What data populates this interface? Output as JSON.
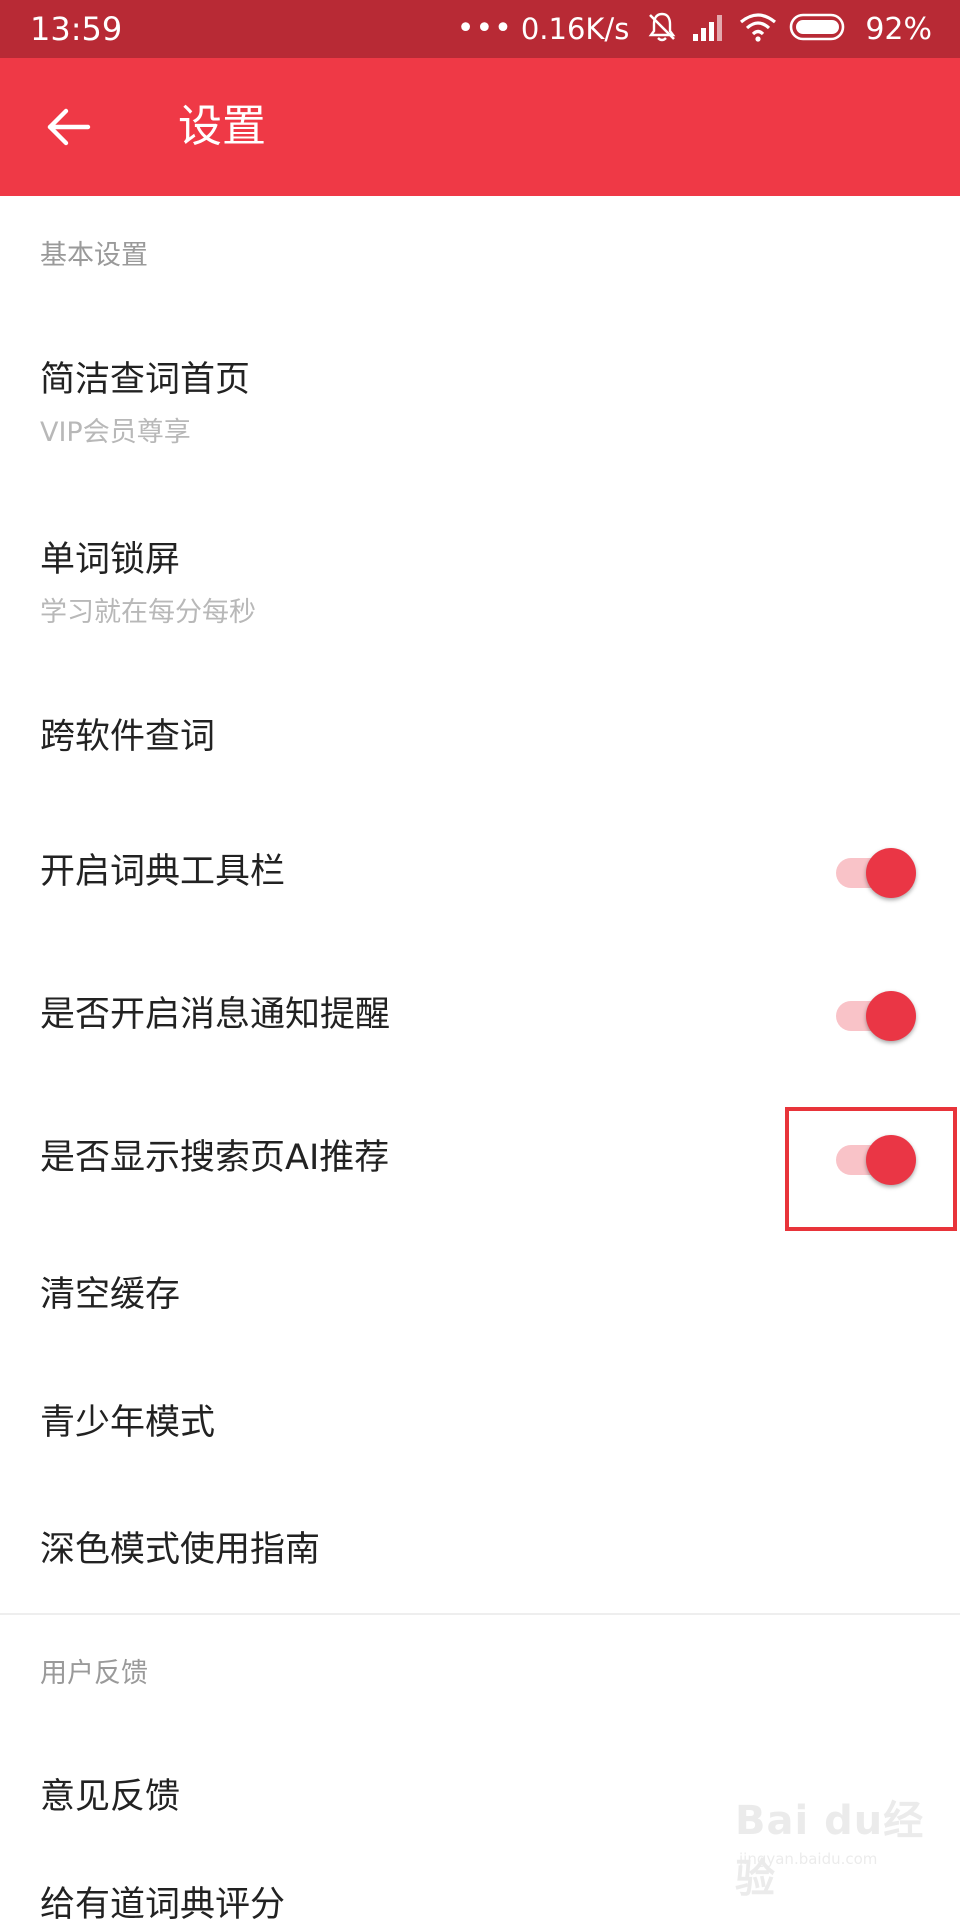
{
  "status_bar": {
    "time": "13:59",
    "dots": "•••",
    "speed": "0.16K/s",
    "battery_percent": "92%"
  },
  "app_bar": {
    "title": "设置"
  },
  "sections": {
    "basic": {
      "header": "基本设置",
      "items": [
        {
          "title": "简洁查词首页",
          "subtitle": "VIP会员尊享"
        },
        {
          "title": "单词锁屏",
          "subtitle": "学习就在每分每秒"
        },
        {
          "title": "跨软件查词"
        },
        {
          "title": "开启词典工具栏",
          "toggle_on": true
        },
        {
          "title": "是否开启消息通知提醒",
          "toggle_on": true
        },
        {
          "title": "是否显示搜索页AI推荐",
          "toggle_on": true
        },
        {
          "title": "清空缓存"
        },
        {
          "title": "青少年模式"
        },
        {
          "title": "深色模式使用指南"
        }
      ]
    },
    "feedback": {
      "header": "用户反馈",
      "items": [
        {
          "title": "意见反馈"
        },
        {
          "title": "给有道词典评分"
        }
      ]
    }
  },
  "watermark": {
    "logo": "Bai du经验",
    "url": "jingyan.baidu.com"
  },
  "colors": {
    "status_bar": "#b82a35",
    "app_bar": "#ef3946",
    "toggle_knob": "#ea3645",
    "toggle_track": "#f9c3c8",
    "highlight": "#e8343a"
  }
}
